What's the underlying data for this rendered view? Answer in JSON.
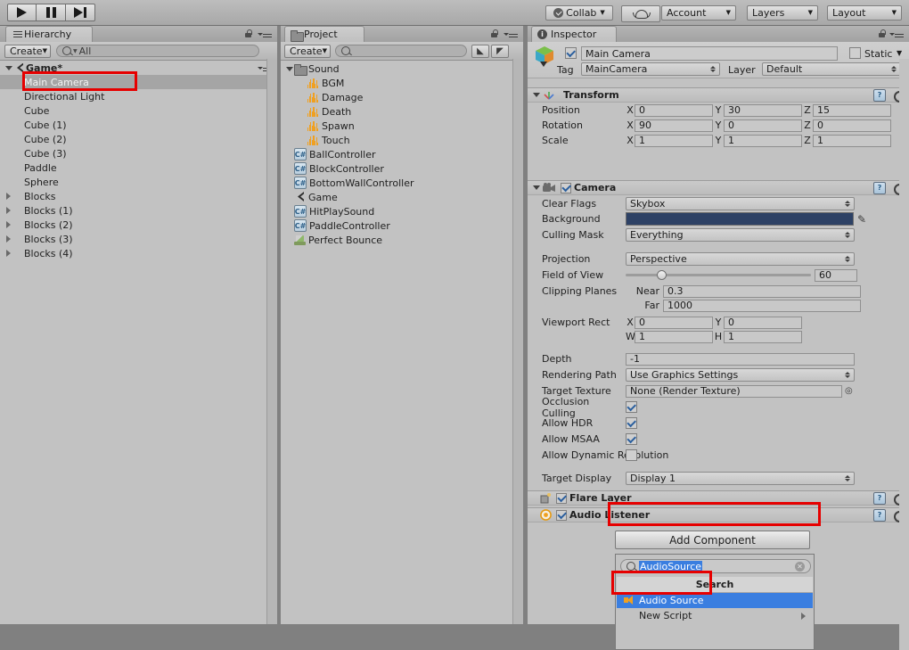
{
  "toolbar": {
    "play_label": "play-icon",
    "pause_label": "pause-icon",
    "step_label": "step-icon",
    "collab": "Collab",
    "cloud": "cloud-icon",
    "account": "Account",
    "layers": "Layers",
    "layout": "Layout"
  },
  "hierarchy": {
    "tab": "Hierarchy",
    "create": "Create",
    "search_placeholder": "All",
    "scene": "Game*",
    "items": [
      {
        "label": "Main Camera",
        "indent": 1,
        "arrow": false,
        "selected": true
      },
      {
        "label": "Directional Light",
        "indent": 1,
        "arrow": false,
        "selected": false
      },
      {
        "label": "Cube",
        "indent": 1,
        "arrow": false,
        "selected": false
      },
      {
        "label": "Cube (1)",
        "indent": 1,
        "arrow": false,
        "selected": false
      },
      {
        "label": "Cube (2)",
        "indent": 1,
        "arrow": false,
        "selected": false
      },
      {
        "label": "Cube (3)",
        "indent": 1,
        "arrow": false,
        "selected": false
      },
      {
        "label": "Paddle",
        "indent": 1,
        "arrow": false,
        "selected": false
      },
      {
        "label": "Sphere",
        "indent": 1,
        "arrow": false,
        "selected": false
      },
      {
        "label": "Blocks",
        "indent": 1,
        "arrow": true,
        "selected": false
      },
      {
        "label": "Blocks (1)",
        "indent": 1,
        "arrow": true,
        "selected": false
      },
      {
        "label": "Blocks (2)",
        "indent": 1,
        "arrow": true,
        "selected": false
      },
      {
        "label": "Blocks (3)",
        "indent": 1,
        "arrow": true,
        "selected": false
      },
      {
        "label": "Blocks (4)",
        "indent": 1,
        "arrow": true,
        "selected": false
      }
    ]
  },
  "project": {
    "tab": "Project",
    "create": "Create",
    "search_placeholder": "",
    "items": [
      {
        "label": "Sound",
        "icon": "folder",
        "indent": 0,
        "arrow": true
      },
      {
        "label": "BGM",
        "icon": "audio",
        "indent": 1,
        "arrow": false
      },
      {
        "label": "Damage",
        "icon": "audio",
        "indent": 1,
        "arrow": false
      },
      {
        "label": "Death",
        "icon": "audio",
        "indent": 1,
        "arrow": false
      },
      {
        "label": "Spawn",
        "icon": "audio",
        "indent": 1,
        "arrow": false
      },
      {
        "label": "Touch",
        "icon": "audio",
        "indent": 1,
        "arrow": false
      },
      {
        "label": "BallController",
        "icon": "cs",
        "indent": 0,
        "arrow": false
      },
      {
        "label": "BlockController",
        "icon": "cs",
        "indent": 0,
        "arrow": false
      },
      {
        "label": "BottomWallController",
        "icon": "cs",
        "indent": 0,
        "arrow": false
      },
      {
        "label": "Game",
        "icon": "unity",
        "indent": 0,
        "arrow": false
      },
      {
        "label": "HitPlaySound",
        "icon": "cs",
        "indent": 0,
        "arrow": false
      },
      {
        "label": "PaddleController",
        "icon": "cs",
        "indent": 0,
        "arrow": false
      },
      {
        "label": "Perfect Bounce",
        "icon": "prefab",
        "indent": 0,
        "arrow": false
      }
    ]
  },
  "inspector": {
    "tab": "Inspector",
    "object_name": "Main Camera",
    "object_enabled": true,
    "static_label": "Static",
    "static_checked": false,
    "tag_label": "Tag",
    "tag_value": "MainCamera",
    "layer_label": "Layer",
    "layer_value": "Default",
    "transform": {
      "title": "Transform",
      "rows": [
        {
          "label": "Position",
          "x": "0",
          "y": "30",
          "z": "15"
        },
        {
          "label": "Rotation",
          "x": "90",
          "y": "0",
          "z": "0"
        },
        {
          "label": "Scale",
          "x": "1",
          "y": "1",
          "z": "1"
        }
      ]
    },
    "camera": {
      "title": "Camera",
      "enabled": true,
      "clear_flags_label": "Clear Flags",
      "clear_flags_value": "Skybox",
      "background_label": "Background",
      "background_color": "#2d4165",
      "culling_mask_label": "Culling Mask",
      "culling_mask_value": "Everything",
      "projection_label": "Projection",
      "projection_value": "Perspective",
      "fov_label": "Field of View",
      "fov_value": "60",
      "fov_percent": 17,
      "clipping_label": "Clipping Planes",
      "near_label": "Near",
      "near_value": "0.3",
      "far_label": "Far",
      "far_value": "1000",
      "viewport_label": "Viewport Rect",
      "viewport_x": "0",
      "viewport_y": "0",
      "viewport_w": "1",
      "viewport_h": "1",
      "depth_label": "Depth",
      "depth_value": "-1",
      "rendering_path_label": "Rendering Path",
      "rendering_path_value": "Use Graphics Settings",
      "target_texture_label": "Target Texture",
      "target_texture_value": "None (Render Texture)",
      "occlusion_label": "Occlusion Culling",
      "occlusion_checked": true,
      "hdr_label": "Allow HDR",
      "hdr_checked": true,
      "msaa_label": "Allow MSAA",
      "msaa_checked": true,
      "dynres_label": "Allow Dynamic Resolution",
      "dynres_checked": false,
      "target_display_label": "Target Display",
      "target_display_value": "Display 1"
    },
    "flare_layer": {
      "title": "Flare Layer",
      "enabled": true
    },
    "audio_listener": {
      "title": "Audio Listener",
      "enabled": true
    },
    "add_component": {
      "button_label": "Add Component",
      "search_value": "AudioSource",
      "search_header": "Search",
      "results": [
        {
          "label": "Audio Source",
          "icon": "speaker",
          "selected": true,
          "submenu": false
        },
        {
          "label": "New Script",
          "icon": "none",
          "selected": false,
          "submenu": true
        }
      ]
    }
  },
  "highlights": {
    "accent_color": "#e60000"
  }
}
